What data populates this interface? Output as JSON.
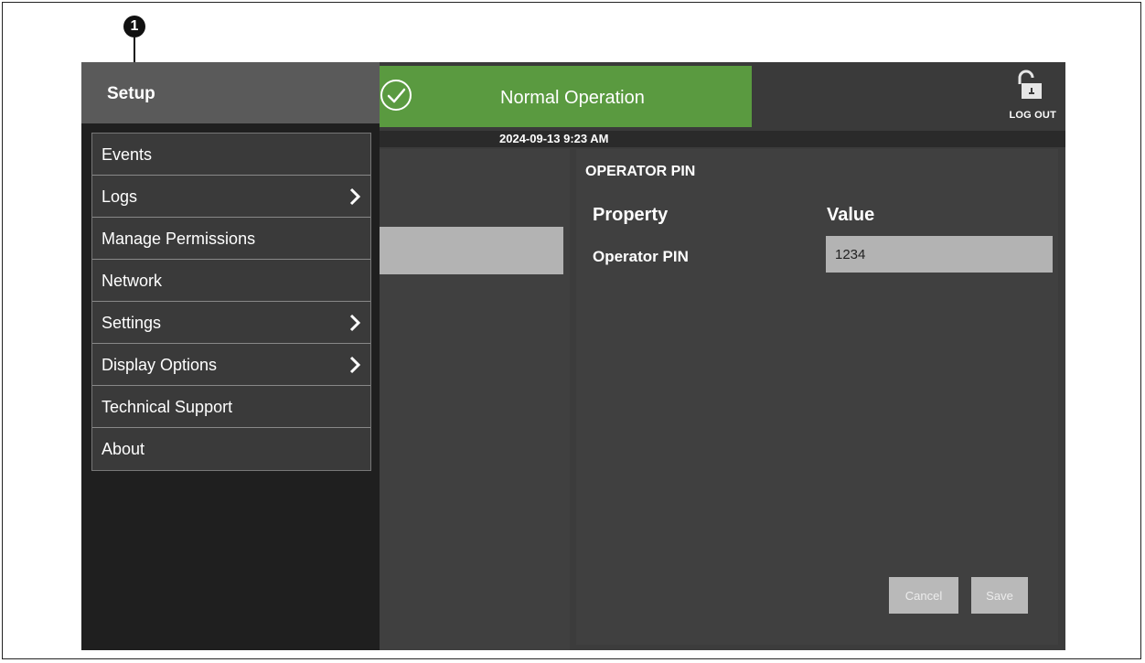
{
  "callout": {
    "number": "1"
  },
  "header": {
    "title": "Setup",
    "status": "Normal Operation",
    "logout_label": "LOG OUT",
    "datetime": "2024-09-13 9:23 AM"
  },
  "sidebar": {
    "items": [
      {
        "label": "Events",
        "has_submenu": false
      },
      {
        "label": "Logs",
        "has_submenu": true
      },
      {
        "label": "Manage Permissions",
        "has_submenu": false
      },
      {
        "label": "Network",
        "has_submenu": false
      },
      {
        "label": "Settings",
        "has_submenu": true
      },
      {
        "label": "Display Options",
        "has_submenu": true
      },
      {
        "label": "Technical Support",
        "has_submenu": false
      },
      {
        "label": "About",
        "has_submenu": false
      }
    ]
  },
  "main": {
    "section_title": "OPERATOR PIN",
    "columns": {
      "property": "Property",
      "value": "Value"
    },
    "rows": [
      {
        "property": "Operator PIN",
        "value": "1234"
      }
    ],
    "buttons": {
      "cancel": "Cancel",
      "save": "Save"
    }
  },
  "colors": {
    "status_ok": "#5a9a40",
    "sidebar_bg": "#1f1f1f",
    "panel_bg": "#404040",
    "header_bg": "#5a5a5a"
  }
}
